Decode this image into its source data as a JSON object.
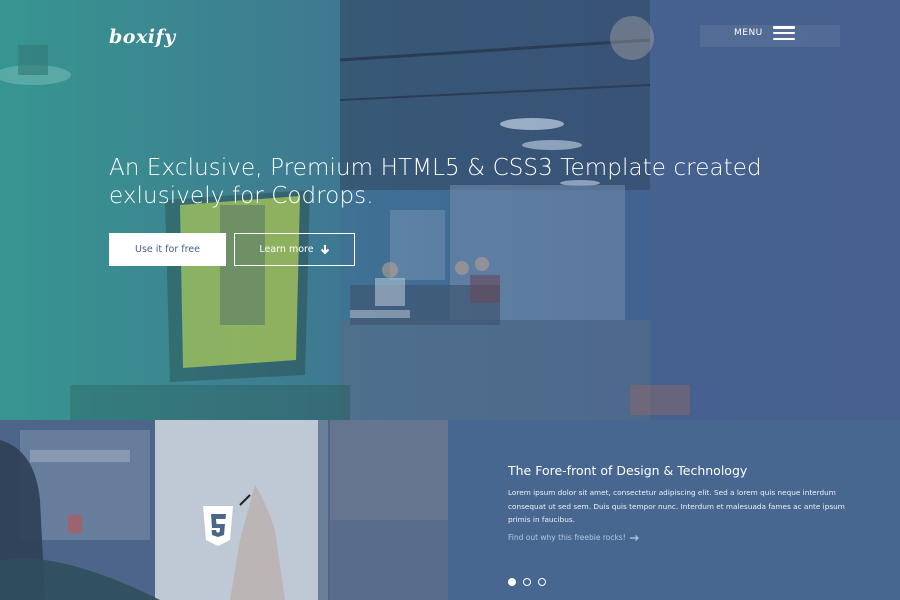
{
  "header": {
    "logo": "boxify",
    "menu_label": "MENU"
  },
  "hero": {
    "title": "An Exclusive, Premium HTML5 & CSS3 Template created exlusively for Codrops.",
    "primary_button": "Use it for free",
    "secondary_button": "Learn more"
  },
  "feature": {
    "title": "The Fore-front of Design & Technology",
    "text": "Lorem ipsum dolor sit amet, consectetur adipiscing elit. Sed a lorem quis neque interdum consequat ut sed sem. Duis quis tempor nunc. Interdum et malesuada fames ac ante ipsum primis in faucibus.",
    "link": "Find out why this freebie rocks!",
    "slides": [
      true,
      false,
      false
    ]
  },
  "icons": [
    "hamburger-icon",
    "arrow-down-icon",
    "arrow-right-icon",
    "html5-icon"
  ],
  "colors": {
    "brand_blue": "#45618e",
    "teal": "#2f8a86",
    "panel": "#476690"
  }
}
